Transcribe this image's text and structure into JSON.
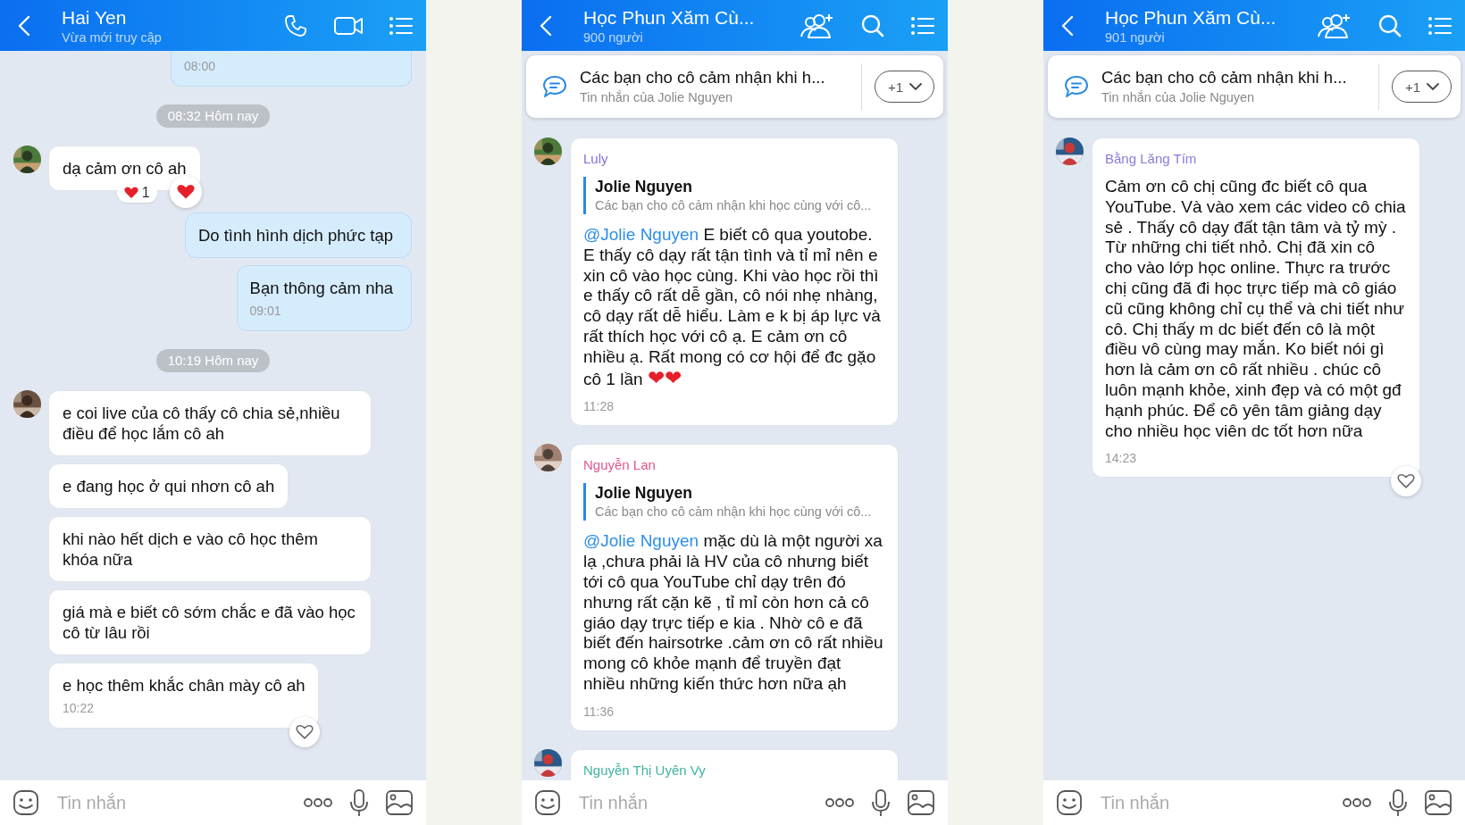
{
  "panels": [
    {
      "kind": "direct",
      "header": {
        "title": "Hai Yen",
        "subtitle": "Vừa mới truy cập",
        "actions": [
          {
            "kind": "phone"
          },
          {
            "kind": "video"
          },
          {
            "kind": "list"
          }
        ]
      },
      "messages": [
        {
          "kind": "outgoing",
          "time": "08:00",
          "cut_top": true
        },
        {
          "kind": "divider",
          "text": "08:32 Hôm nay"
        },
        {
          "kind": "incoming",
          "avatar": true,
          "text": "dạ cảm ơn cô ah",
          "reaction_count": "1",
          "liked": true
        },
        {
          "kind": "outgoing",
          "text": "Do tình hình dịch phức tạp"
        },
        {
          "kind": "outgoing",
          "text": "Bạn thông cảm nha",
          "time": "09:01"
        },
        {
          "kind": "divider",
          "text": "10:19 Hôm nay"
        },
        {
          "kind": "incoming",
          "avatar": true,
          "text": "e coi live của cô thấy cô chia sẻ,nhiều điều  để học lắm cô ah"
        },
        {
          "kind": "incoming",
          "avatar": false,
          "text": "e đang học ở qui nhơn cô ah"
        },
        {
          "kind": "incoming",
          "avatar": false,
          "text": "khi nào hết dịch e vào cô học thêm khóa nữa"
        },
        {
          "kind": "incoming",
          "avatar": false,
          "text": "giá mà e biết cô sớm chắc e đã vào học cô từ lâu rồi"
        },
        {
          "kind": "incoming",
          "avatar": false,
          "text": "e học thêm khắc chân mày cô ah",
          "time": "10:22",
          "liked": false
        }
      ],
      "composer": {
        "placeholder": "Tin nhắn"
      }
    },
    {
      "kind": "group",
      "header": {
        "title": "Học Phun Xăm Cù...",
        "subtitle": "900 người",
        "actions": [
          {
            "kind": "add_member"
          },
          {
            "kind": "search"
          },
          {
            "kind": "list"
          }
        ]
      },
      "pinned": {
        "title": "Các bạn cho cô cảm nhận khi h...",
        "subtitle": "Tin nhắn của Jolie Nguyen",
        "more": "+1"
      },
      "messages": [
        {
          "kind": "group",
          "sender": "Luly",
          "color": "#8470d8",
          "quote": {
            "name": "Jolie Nguyen",
            "text": "Các bạn cho cô cảm nhận khi học cùng với cô..."
          },
          "mention": "@Jolie Nguyen",
          "text": "E biết cô qua youtobe. E thấy cô dạy rất tận tình và tỉ mỉ nên e xin cô vào học cùng. Khi vào học rồi thì e thấy cô rất dễ gần, cô nói nhẹ nhàng, cô dạy rất dễ hiểu. Làm e k bị áp lực và rất thích học với cô ạ. E cảm ơn cô nhiều ạ. Rất mong có cơ hội để đc gặo cô 1 lần",
          "emoji": "❤❤",
          "time": "11:28"
        },
        {
          "kind": "group",
          "sender": "Nguyễn Lan",
          "color": "#e05591",
          "quote": {
            "name": "Jolie Nguyen",
            "text": "Các bạn cho cô cảm nhận khi học cùng với cô..."
          },
          "mention": "@Jolie Nguyen",
          "text": "mặc dù là một người xa lạ ,chưa phải là HV của cô nhưng biết tới cô qua YouTube chỉ dạy trên đó nhưng rất cặn kẽ , tỉ mỉ còn hơn cả cô giáo dạy trực tiếp e kia . Nhờ cô e đã biết đến hairsotrke .cảm ơn cô rất nhiều mong cô khỏe mạnh để truyền đạt nhiều những kiến thức hơn nữa ạh",
          "time": "11:36"
        },
        {
          "kind": "group",
          "sender": "Nguyễn Thị Uyên Vy",
          "color": "#3fb4a2"
        }
      ],
      "composer": {
        "placeholder": "Tin nhắn"
      }
    },
    {
      "kind": "group",
      "header": {
        "title": "Học Phun Xăm Cù...",
        "subtitle": "901 người",
        "actions": [
          {
            "kind": "add_member"
          },
          {
            "kind": "search"
          },
          {
            "kind": "list"
          }
        ]
      },
      "pinned": {
        "title": "Các bạn cho cô cảm nhận khi h...",
        "subtitle": "Tin nhắn của Jolie Nguyen",
        "more": "+1"
      },
      "messages": [
        {
          "kind": "group",
          "sender": "Bằng Lăng Tím",
          "color": "#8a7ad8",
          "text": "Cảm ơn cô chị cũng đc biết cô qua YouTube. Và vào xem các video cô chia sẻ . Thấy cô dạy đất tận tâm và tỷ mỳ . Từ những chi tiết nhỏ. Chị đã xin cô cho vào lớp học online. Thực ra trước chị cũng đã đi học trực tiếp mà cô giáo cũ cũng không chỉ cụ thể và chi tiết như cô. Chị thấy m dc biết đến cô là một điều vô cùng may mắn. Ko biết nói gì hơn là cảm ơn cô rất nhiều . chúc cô luôn mạnh khỏe, xinh đẹp và có một gđ hạnh phúc. Để cô yên tâm giảng dạy cho nhiều học viên dc tốt hơn nữa",
          "time": "14:23",
          "liked": false
        }
      ],
      "composer": {
        "placeholder": "Tin nhắn"
      }
    }
  ]
}
